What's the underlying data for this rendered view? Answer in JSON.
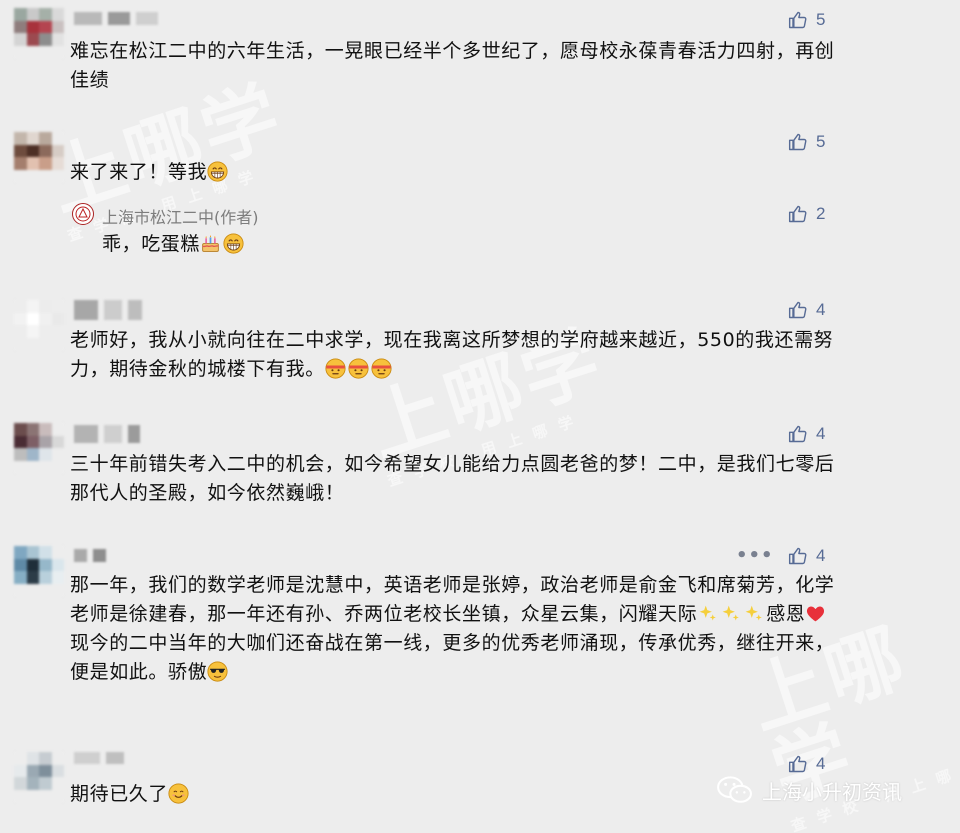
{
  "comments": [
    {
      "likes": "5",
      "text": "难忘在松江二中的六年生活，一晃眼已经半个多世纪了，愿母校永葆青春活力四射，再创佳绩"
    },
    {
      "likes": "5",
      "text": "来了来了！等我",
      "reply": {
        "author": "上海市松江二中(作者)",
        "likes": "2",
        "text": "乖，吃蛋糕"
      }
    },
    {
      "likes": "4",
      "text": "老师好，我从小就向往在二中求学，现在我离这所梦想的学府越来越近，550的我还需努力，期待金秋的城楼下有我。"
    },
    {
      "likes": "4",
      "text": "三十年前错失考入二中的机会，如今希望女儿能给力点圆老爸的梦！二中，是我们七零后那代人的圣殿，如今依然巍峨！"
    },
    {
      "likes": "4",
      "text": "那一年，我们的数学老师是沈慧中，英语老师是张婷，政治老师是俞金飞和席菊芳，化学老师是徐建春，那一年还有孙、乔两位老校长坐镇，众星云集，闪耀天际",
      "text_tail": "感恩",
      "text2": "现今的二中当年的大咖们还奋战在第一线，更多的优秀老师涌现，传承优秀，继往开来，便是如此。骄傲",
      "more": "•••"
    },
    {
      "likes": "4",
      "text": "期待已久了"
    }
  ],
  "watermark": {
    "main": "上哪学",
    "sub": "查学校 用上哪学"
  },
  "brand": {
    "name": "上海小升初资讯",
    "icon": "wechat-icon"
  },
  "colors": {
    "background": "#ededed",
    "like_blue": "#576b95",
    "author_gray": "#7d7d7d"
  }
}
